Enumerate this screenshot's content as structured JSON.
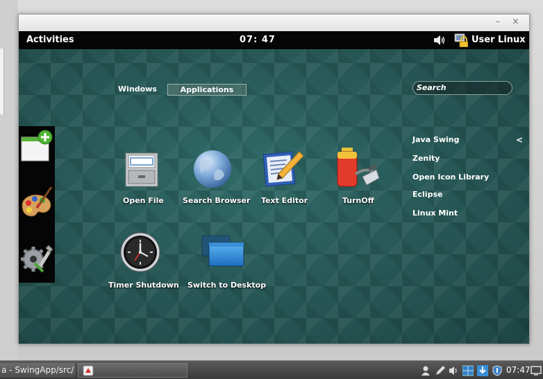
{
  "panel": {
    "activities_label": "Activities",
    "clock": "07: 47",
    "user_name": "User Linux"
  },
  "view_switcher": {
    "windows_label": "Windows",
    "applications_label": "Applications"
  },
  "search": {
    "placeholder": "Search"
  },
  "dash": {
    "items": [
      "add-item-icon",
      "palette-icon",
      "settings-tools-icon"
    ]
  },
  "apps": [
    {
      "label": "Open File",
      "icon": "file-cabinet-icon"
    },
    {
      "label": "Search Browser",
      "icon": "globe-icon"
    },
    {
      "label": "Text Editor",
      "icon": "text-editor-icon"
    },
    {
      "label": "TurnOff",
      "icon": "battery-plug-icon"
    },
    {
      "label": "Timer Shutdown",
      "icon": "clock-icon"
    },
    {
      "label": "Switch to Desktop",
      "icon": "desktop-windows-icon"
    }
  ],
  "categories": {
    "items": [
      "Java Swing",
      "Zenity",
      "Open Icon Library",
      "Eclipse",
      "Linux Mint"
    ],
    "arrow": "<"
  },
  "window_controls": {
    "minimize": "–",
    "close": "×"
  },
  "taskbar": {
    "main_task_label": "a - SwingApp/src/...",
    "clock": "07:47"
  },
  "colors": {
    "background": "#2a5a58",
    "panel": "#050505",
    "accent_blue": "#2f7fc8"
  }
}
